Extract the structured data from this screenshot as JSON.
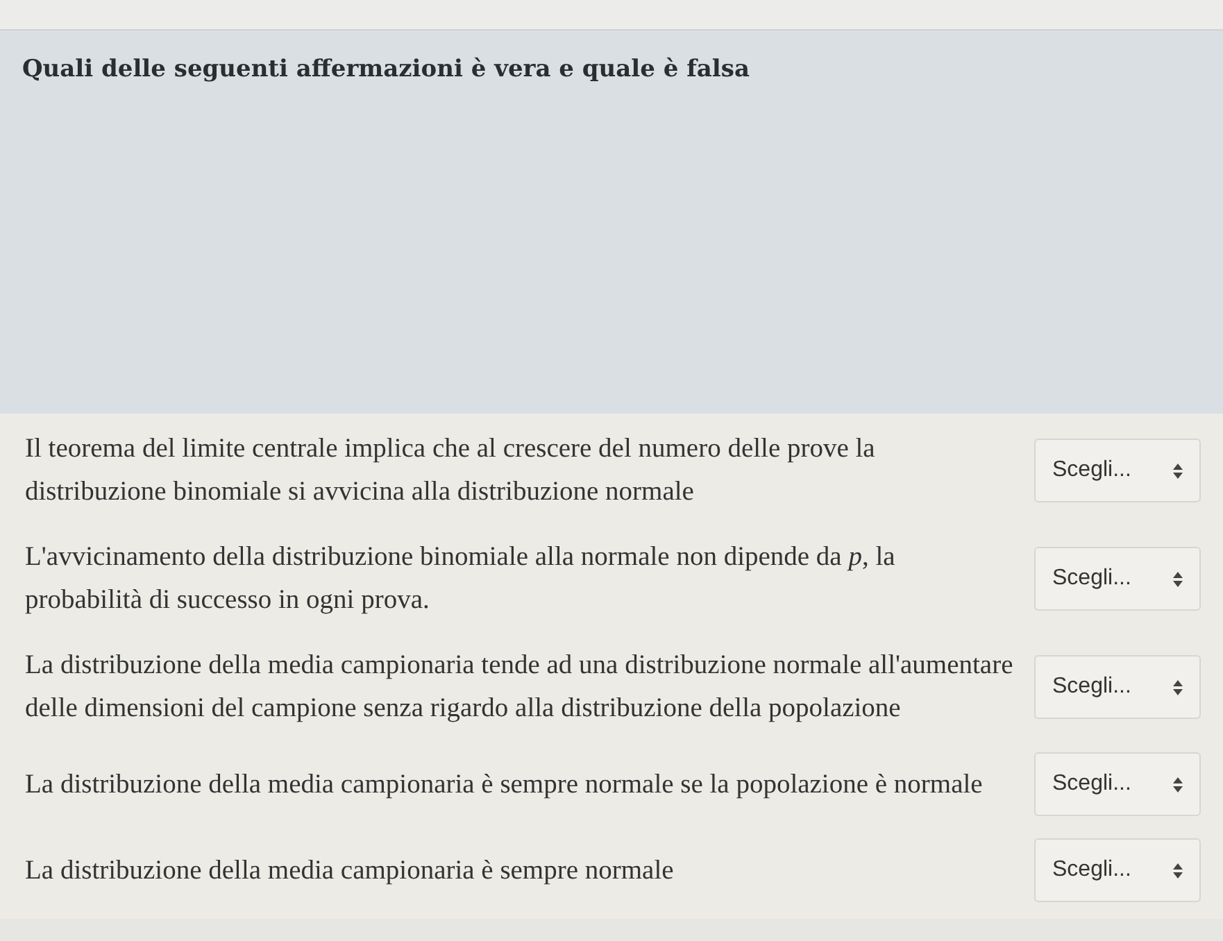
{
  "question": {
    "title": "Quali delle seguenti affermazioni è vera e quale è falsa"
  },
  "rows": [
    {
      "statement": "Il teorema del limite centrale implica che al crescere del numero delle prove la distribuzione binomiale si avvicina alla distribuzione normale",
      "answer": "Scegli..."
    },
    {
      "statement": "L'avvicinamento della distribuzione binomiale alla normale non dipende da *p*, la probabilità di successo in ogni prova.",
      "answer": "Scegli..."
    },
    {
      "statement": "La distribuzione della media campionaria tende ad una distribuzione normale all'aumentare delle dimensioni del campione senza rigardo alla distribuzione della popolazione",
      "answer": "Scegli..."
    },
    {
      "statement": "La distribuzione della media campionaria è sempre normale se la popolazione è normale",
      "answer": "Scegli..."
    },
    {
      "statement": "La distribuzione della media campionaria è sempre normale",
      "answer": "Scegli..."
    }
  ]
}
